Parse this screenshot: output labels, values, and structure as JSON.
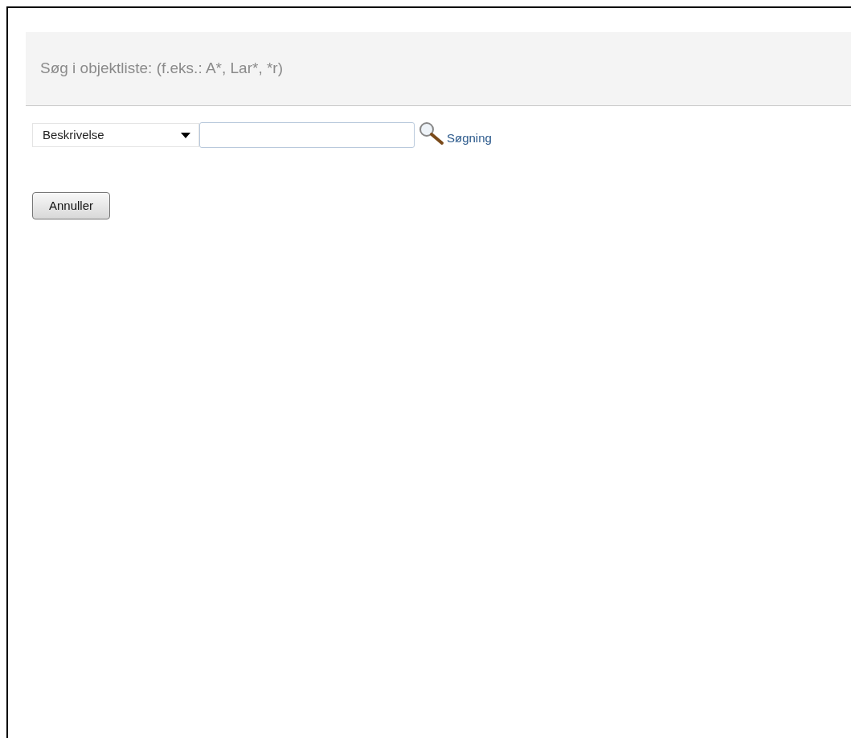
{
  "header": {
    "title": "Søg i objektliste: (f.eks.: A*, Lar*, *r)"
  },
  "search": {
    "field_select": "Beskrivelse",
    "search_link": "Søgning"
  },
  "buttons": [
    {
      "label": "Annuller"
    }
  ]
}
